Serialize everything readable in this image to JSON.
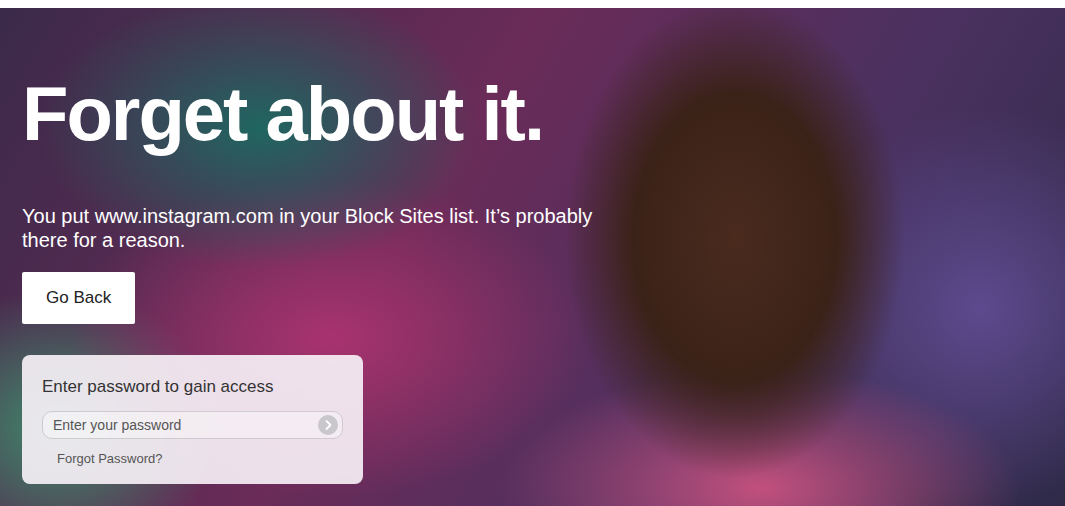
{
  "page": {
    "title": "Forget about it.",
    "message": "You put www.instagram.com in your Block Sites list. It’s probably there for a reason."
  },
  "buttons": [
    "Go Back"
  ],
  "password": {
    "label": "Enter password to gain access",
    "placeholder": "Enter your password",
    "forgot_link": "Forgot Password?"
  }
}
